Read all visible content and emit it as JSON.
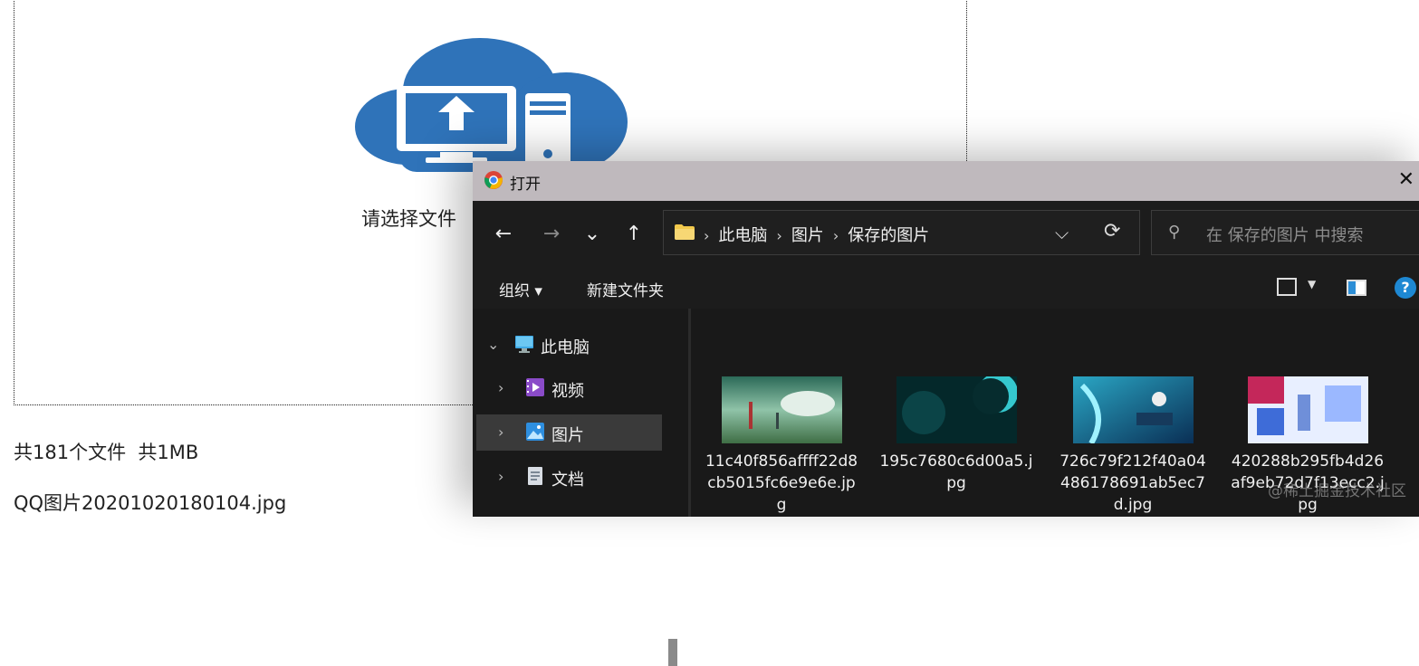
{
  "page": {
    "drop_label": "请选择文件",
    "summary": "共181个文件  共1MB",
    "first_file": "QQ图片20201020180104.jpg"
  },
  "dialog": {
    "title": "打开",
    "close_glyph": "✕",
    "nav": {
      "back": "←",
      "forward": "→",
      "recent": "⌄",
      "up": "↑"
    },
    "breadcrumbs": [
      "此电脑",
      "图片",
      "保存的图片"
    ],
    "search_placeholder": "在 保存的图片 中搜索",
    "commands": {
      "organize": "组织 ▾",
      "new_folder": "新建文件夹",
      "help": "?"
    },
    "sidebar": [
      {
        "label": "此电脑",
        "icon": "computer-icon",
        "expanded": true
      },
      {
        "label": "视频",
        "icon": "video-folder-icon"
      },
      {
        "label": "图片",
        "icon": "pictures-folder-icon",
        "selected": true
      },
      {
        "label": "文档",
        "icon": "documents-folder-icon"
      }
    ],
    "files": [
      {
        "name": "11c40f856affff22d8cb5015fc6e9e6e.jpg",
        "colors": [
          "#1d4d3e",
          "#7ab5a0",
          "#dceae3"
        ]
      },
      {
        "name": "195c7680c6d00a5.jpg",
        "colors": [
          "#052a2d",
          "#0c4c50",
          "#34d0d6"
        ]
      },
      {
        "name": "726c79f212f40a04486178691ab5ec7d.jpg",
        "colors": [
          "#0b3b5c",
          "#39b3c9",
          "#a7e6f3"
        ]
      },
      {
        "name": "420288b295fb4d26af9eb72d7f13ecc2.jpg",
        "colors": [
          "#c4275a",
          "#3e6cd8",
          "#e8f2ff"
        ]
      }
    ]
  },
  "watermark": "@稀土掘金技术社区",
  "colors": {
    "accent": "#2f73b9",
    "dialog_bg": "#191919",
    "titlebar": "#bfb9bd"
  }
}
